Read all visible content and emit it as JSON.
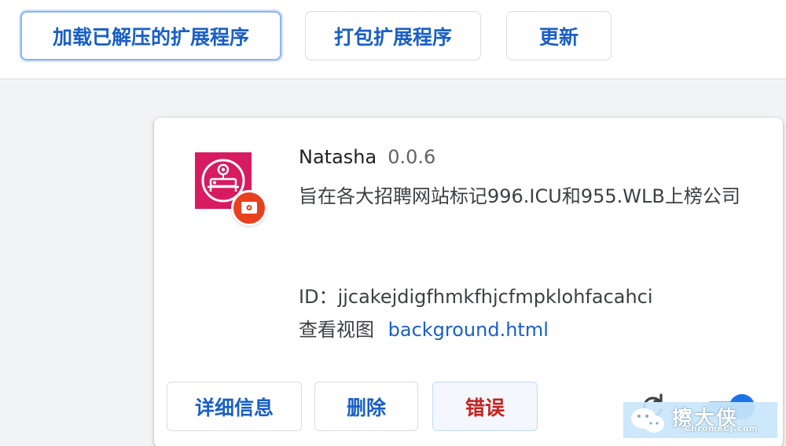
{
  "toolbar": {
    "load_unpacked": "加载已解压的扩展程序",
    "pack_extension": "打包扩展程序",
    "update": "更新"
  },
  "extension": {
    "name": "Natasha",
    "version": "0.0.6",
    "description": "旨在各大招聘网站标记996.ICU和955.WLB上榜公司",
    "id_label": "ID：",
    "id_value": "jjcakejdigfhmkfhjcfmpklohfacahci",
    "views_label": "查看视图",
    "views_link": "background.html",
    "icon": "natasha-extension-icon",
    "badge_icon": "unpacked-extension-badge-icon",
    "enabled": true,
    "accent_color": "#d81b60"
  },
  "actions": {
    "details": "详细信息",
    "remove": "删除",
    "errors": "错误",
    "reload_icon": "reload-icon"
  },
  "watermark": {
    "text": "擦大侠",
    "url": "ChromeCJ.com"
  }
}
